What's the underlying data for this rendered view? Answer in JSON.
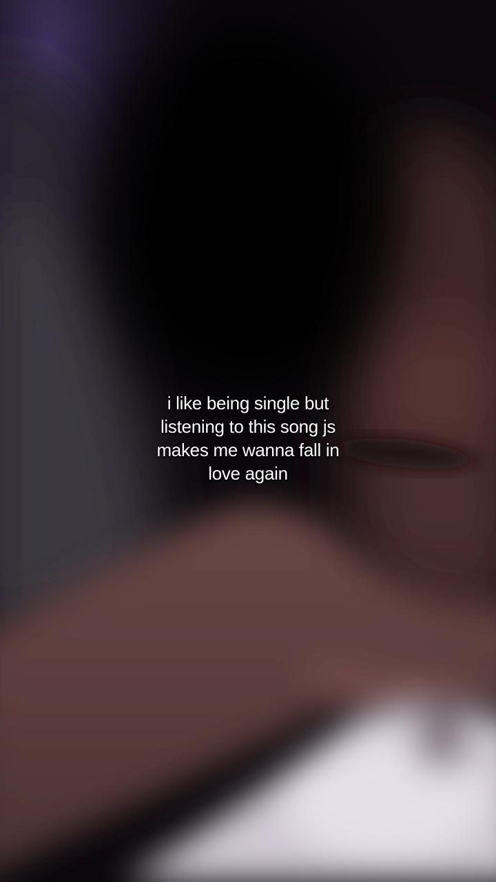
{
  "overlay": {
    "caption_lines": [
      "i like being single but",
      "listening to this song js",
      "makes me wanna fall in",
      "love again"
    ]
  },
  "colors": {
    "background": "#0a070b",
    "text": "#ffffff"
  }
}
